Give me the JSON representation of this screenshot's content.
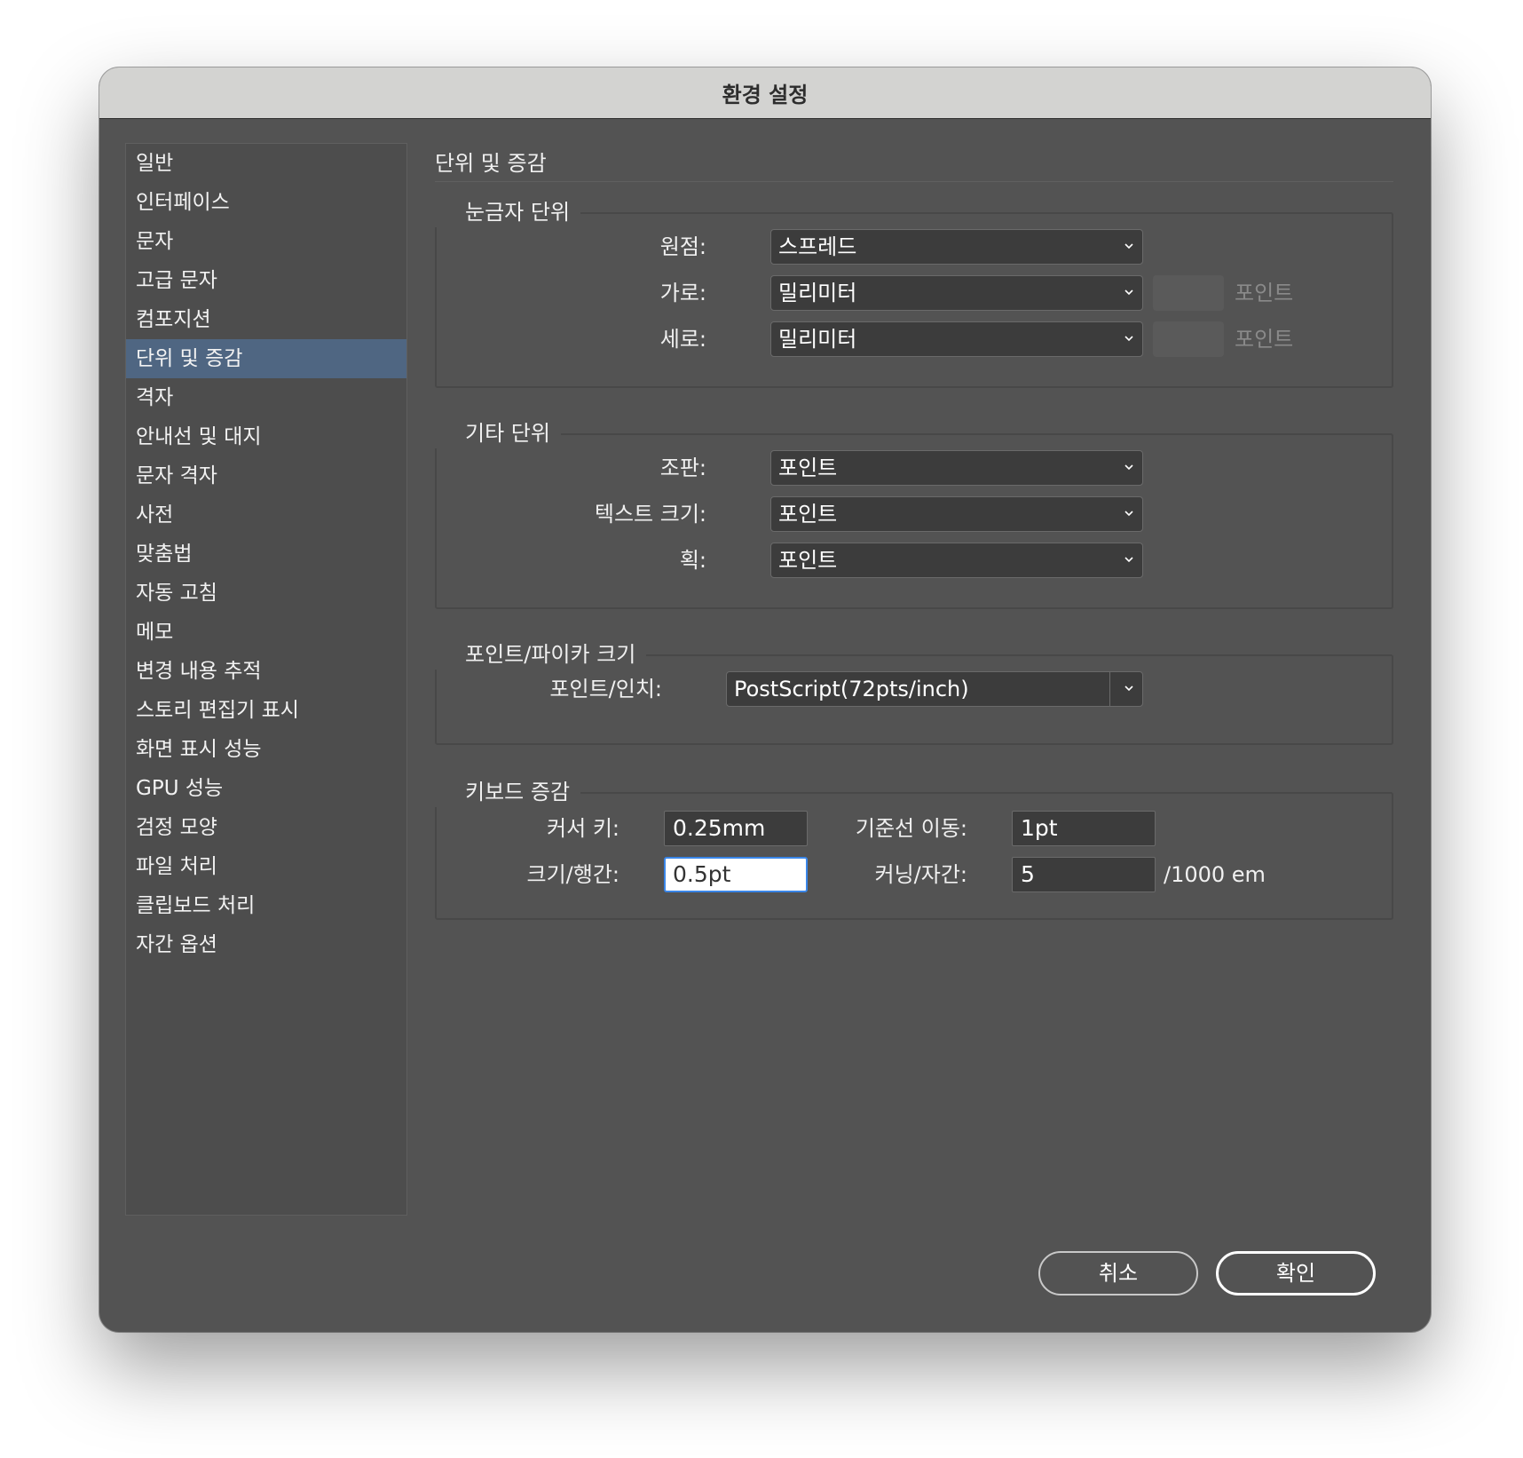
{
  "window": {
    "title": "환경 설정"
  },
  "sidebar": {
    "items": [
      {
        "label": "일반",
        "active": false
      },
      {
        "label": "인터페이스",
        "active": false
      },
      {
        "label": "문자",
        "active": false
      },
      {
        "label": "고급 문자",
        "active": false
      },
      {
        "label": "컴포지션",
        "active": false
      },
      {
        "label": "단위 및 증감",
        "active": true
      },
      {
        "label": "격자",
        "active": false
      },
      {
        "label": "안내선 및 대지",
        "active": false
      },
      {
        "label": "문자 격자",
        "active": false
      },
      {
        "label": "사전",
        "active": false
      },
      {
        "label": "맞춤법",
        "active": false
      },
      {
        "label": "자동 고침",
        "active": false
      },
      {
        "label": "메모",
        "active": false
      },
      {
        "label": "변경 내용 추적",
        "active": false
      },
      {
        "label": "스토리 편집기 표시",
        "active": false
      },
      {
        "label": "화면 표시 성능",
        "active": false
      },
      {
        "label": "GPU 성능",
        "active": false
      },
      {
        "label": "검정 모양",
        "active": false
      },
      {
        "label": "파일 처리",
        "active": false
      },
      {
        "label": "클립보드 처리",
        "active": false
      },
      {
        "label": "자간 옵션",
        "active": false
      }
    ]
  },
  "main": {
    "section_title": "단위 및 증감",
    "ruler_units": {
      "title": "눈금자 단위",
      "origin_label": "원점:",
      "origin_value": "스프레드",
      "horizontal_label": "가로:",
      "horizontal_value": "밀리미터",
      "horizontal_unit": "포인트",
      "vertical_label": "세로:",
      "vertical_value": "밀리미터",
      "vertical_unit": "포인트"
    },
    "other_units": {
      "title": "기타 단위",
      "composition_label": "조판:",
      "composition_value": "포인트",
      "text_size_label": "텍스트 크기:",
      "text_size_value": "포인트",
      "stroke_label": "획:",
      "stroke_value": "포인트"
    },
    "point_pica": {
      "title": "포인트/파이카 크기",
      "points_inch_label": "포인트/인치:",
      "points_inch_value": "PostScript(72pts/inch)"
    },
    "keyboard": {
      "title": "키보드 증감",
      "cursor_key_label": "커서 키:",
      "cursor_key_value": "0.25mm",
      "baseline_label": "기준선 이동:",
      "baseline_value": "1pt",
      "size_leading_label": "크기/행간:",
      "size_leading_value": "0.5pt",
      "kerning_label": "커닝/자간:",
      "kerning_value": "5",
      "kerning_unit": "/1000 em"
    }
  },
  "footer": {
    "cancel_label": "취소",
    "ok_label": "확인"
  },
  "colors": {
    "background": "#535353",
    "sidebar_active": "#4f6682",
    "focus_ring": "#3a86e8"
  }
}
